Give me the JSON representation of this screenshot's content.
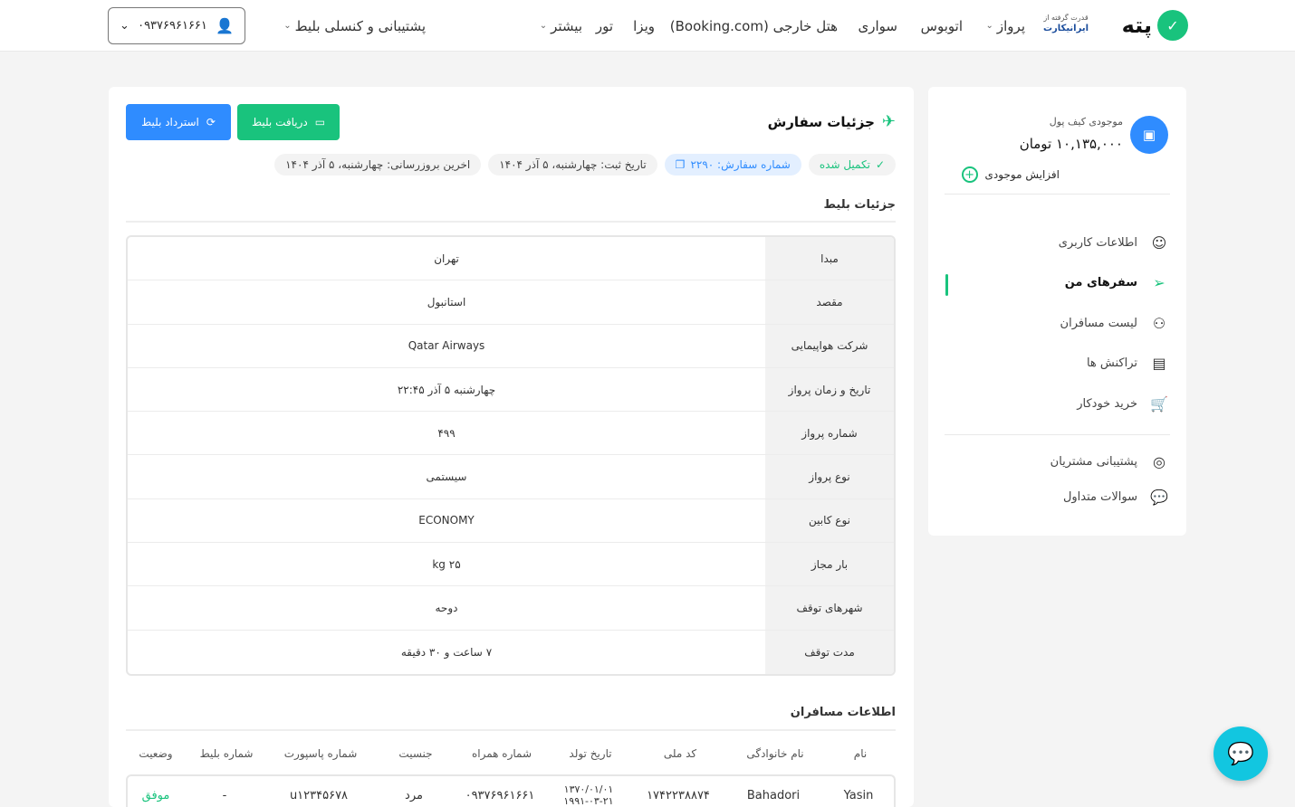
{
  "header": {
    "brand": "پته",
    "partner_line1": "قدرت گرفته از",
    "partner_line2": "ایرانیکارت",
    "nav": [
      "پرواز",
      "اتوبوس",
      "سواری",
      "هتل خارجی (Booking.com)",
      "ویزا",
      "تور",
      "بیشتر"
    ],
    "support": "پشتیبانی و کنسلی بلیط",
    "phone": "۰۹۳۷۶۹۶۱۶۶۱"
  },
  "sidebar": {
    "wallet_label": "موجودی کیف پول",
    "wallet_amount": "۱۰,۱۳۵,۰۰۰ تومان",
    "add_credit": "افزایش موجودی",
    "menu": [
      {
        "label": "اطلاعات کاربری",
        "icon": "user-icon"
      },
      {
        "label": "سفرهای من",
        "icon": "send-icon"
      },
      {
        "label": "لیست مسافران",
        "icon": "users-icon"
      },
      {
        "label": "تراکنش ها",
        "icon": "receipt-icon"
      },
      {
        "label": "خرید خودکار",
        "icon": "cart-icon"
      }
    ],
    "menu2": [
      {
        "label": "پشتیبانی مشتریان",
        "icon": "support-icon"
      },
      {
        "label": "سوالات متداول",
        "icon": "faq-icon"
      }
    ]
  },
  "order": {
    "title": "جزئیات سفارش",
    "btn_download": "دریافت بلیط",
    "btn_refund": "استرداد بلیط",
    "status": "تکمیل شده",
    "order_number": "شماره سفارش: ۲۲۹۰",
    "registered": "تاریخ ثبت: چهارشنبه، ۵ آذر ۱۴۰۴",
    "updated": "اخرین بروزرسانی: چهارشنبه، ۵ آذر ۱۴۰۴"
  },
  "ticket": {
    "title": "جزئیات بلیط",
    "rows": [
      {
        "label": "مبدا",
        "value": "تهران"
      },
      {
        "label": "مقصد",
        "value": "استانبول"
      },
      {
        "label": "شرکت هواپیمایی",
        "value": "Qatar Airways"
      },
      {
        "label": "تاریخ و زمان پرواز",
        "value": "چهارشنبه ۵ آذر ۲۲:۴۵"
      },
      {
        "label": "شماره پرواز",
        "value": "۴۹۹"
      },
      {
        "label": "نوع پرواز",
        "value": "سیستمی"
      },
      {
        "label": "نوع کابین",
        "value": "ECONOMY"
      },
      {
        "label": "بار مجاز",
        "value": "۲۵ kg"
      },
      {
        "label": "شهرهای توقف",
        "value": "دوحه"
      },
      {
        "label": "مدت توقف",
        "value": "۷ ساعت و ۳۰ دقیقه"
      }
    ]
  },
  "passengers": {
    "title": "اطلاعات مسافران",
    "columns": [
      "نام",
      "نام خانوادگی",
      "کد ملی",
      "تاریخ تولد",
      "شماره همراه",
      "جنسیت",
      "شماره پاسپورت",
      "شماره بلیط",
      "وضعیت"
    ],
    "rows": [
      {
        "first": "Yasin",
        "last": "Bahadori",
        "national_id": "۱۷۴۲۲۳۸۸۷۴",
        "dob_fa": "۱۳۷۰/۰۱/۰۱",
        "dob_en": "۱۹۹۱-۰۳-۲۱",
        "mobile": "۰۹۳۷۶۹۶۱۶۶۱",
        "gender": "مرد",
        "passport": "u۱۲۳۴۵۶۷۸",
        "ticket": "-",
        "status": "موفق"
      }
    ]
  }
}
